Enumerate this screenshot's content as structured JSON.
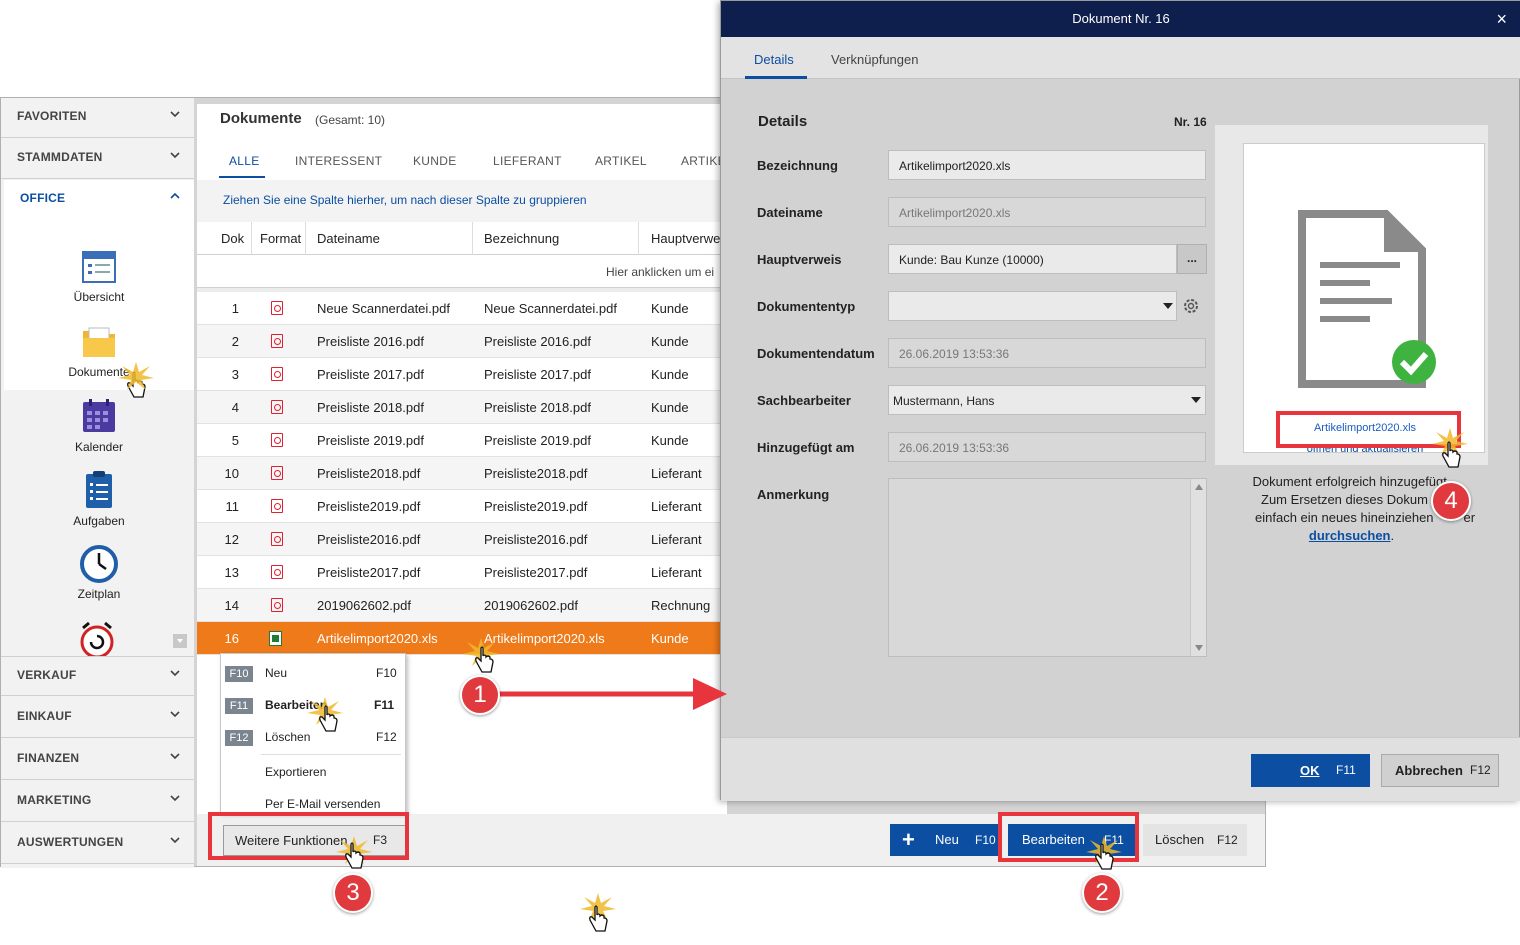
{
  "sidebar": {
    "sections": [
      "FAVORITEN",
      "STAMMDATEN",
      "OFFICE",
      "VERKAUF",
      "EINKAUF",
      "FINANZEN",
      "MARKETING",
      "AUSWERTUNGEN"
    ],
    "office_items": [
      "Übersicht",
      "Dokumente",
      "Kalender",
      "Aufgaben",
      "Zeitplan"
    ]
  },
  "documents": {
    "title": "Dokumente",
    "total": "(Gesamt: 10)",
    "tabs": [
      "ALLE",
      "INTERESSENT",
      "KUNDE",
      "LIEFERANT",
      "ARTIKEL",
      "ARTIKE"
    ],
    "group_hint": "Ziehen Sie eine Spalte hierher, um nach dieser Spalte zu gruppieren",
    "columns": [
      "Dok",
      "Format",
      "Dateiname",
      "Bezeichnung",
      "Hauptverwe"
    ],
    "filter_hint": "Hier anklicken um ei",
    "rows": [
      {
        "nr": "1",
        "file": "Neue Scannerdatei.pdf",
        "desc": "Neue Scannerdatei.pdf",
        "ref": "Kunde",
        "fmt": "pdf"
      },
      {
        "nr": "2",
        "file": "Preisliste 2016.pdf",
        "desc": "Preisliste 2016.pdf",
        "ref": "Kunde",
        "fmt": "pdf"
      },
      {
        "nr": "3",
        "file": "Preisliste 2017.pdf",
        "desc": "Preisliste 2017.pdf",
        "ref": "Kunde",
        "fmt": "pdf"
      },
      {
        "nr": "4",
        "file": "Preisliste 2018.pdf",
        "desc": "Preisliste 2018.pdf",
        "ref": "Kunde",
        "fmt": "pdf"
      },
      {
        "nr": "5",
        "file": "Preisliste 2019.pdf",
        "desc": "Preisliste 2019.pdf",
        "ref": "Kunde",
        "fmt": "pdf"
      },
      {
        "nr": "10",
        "file": "Preisliste2018.pdf",
        "desc": "Preisliste2018.pdf",
        "ref": "Lieferant",
        "fmt": "pdf"
      },
      {
        "nr": "11",
        "file": "Preisliste2019.pdf",
        "desc": "Preisliste2019.pdf",
        "ref": "Lieferant",
        "fmt": "pdf"
      },
      {
        "nr": "12",
        "file": "Preisliste2016.pdf",
        "desc": "Preisliste2016.pdf",
        "ref": "Lieferant",
        "fmt": "pdf"
      },
      {
        "nr": "13",
        "file": "Preisliste2017.pdf",
        "desc": "Preisliste2017.pdf",
        "ref": "Lieferant",
        "fmt": "pdf"
      },
      {
        "nr": "14",
        "file": "2019062602.pdf",
        "desc": "2019062602.pdf",
        "ref": "Rechnung",
        "fmt": "pdf"
      },
      {
        "nr": "16",
        "file": "Artikelimport2020.xls",
        "desc": "Artikelimport2020.xls",
        "ref": "Kunde",
        "fmt": "xls"
      }
    ]
  },
  "context_menu": [
    {
      "key": "F10",
      "label": "Neu",
      "shortcut": "F10"
    },
    {
      "key": "F11",
      "label": "Bearbeiten",
      "shortcut": "F11"
    },
    {
      "key": "F12",
      "label": "Löschen",
      "shortcut": "F12"
    },
    {
      "key": "",
      "label": "Exportieren",
      "shortcut": ""
    },
    {
      "key": "",
      "label": "Per E-Mail versenden",
      "shortcut": ""
    }
  ],
  "bottom_bar": {
    "more_label": "Weitere Funktionen",
    "more_key": "F3",
    "new_label": "Neu",
    "new_key": "F10",
    "edit_label": "Bearbeiten",
    "edit_key": "F11",
    "delete_label": "Löschen",
    "delete_key": "F12"
  },
  "dialog": {
    "title": "Dokument Nr. 16",
    "tabs": [
      "Details",
      "Verknüpfungen"
    ],
    "section": "Details",
    "nr": "Nr. 16",
    "labels": {
      "bezeichnung": "Bezeichnung",
      "dateiname": "Dateiname",
      "hauptverweis": "Hauptverweis",
      "dokumententyp": "Dokumententyp",
      "dokumentendatum": "Dokumentendatum",
      "sachbearbeiter": "Sachbearbeiter",
      "hinzugefuegt": "Hinzugefügt am",
      "anmerkung": "Anmerkung"
    },
    "values": {
      "bezeichnung": "Artikelimport2020.xls",
      "dateiname": "Artikelimport2020.xls",
      "hauptverweis": "Kunde: Bau Kunze (10000)",
      "dokumententyp": "",
      "dokumentendatum": "26.06.2019 13:53:36",
      "sachbearbeiter": "Mustermann, Hans",
      "hinzugefuegt": "26.06.2019 13:53:36"
    },
    "browse_label": "...",
    "preview_file": "Artikelimport2020.xls",
    "preview_link": "öffnen und aktualisieren",
    "msg_line1": "Dokument erfolgreich hinzugefügt.",
    "msg_line2": "Zum Ersetzen dieses Dokum",
    "msg_line3": "einfach ein neues hineinziehen",
    "msg_line3b": "er",
    "msg_link": "durchsuchen",
    "msg_end": ".",
    "ok_label": "OK",
    "ok_key": "F11",
    "cancel_label": "Abbrechen",
    "cancel_key": "F12",
    "close": "×"
  },
  "steps": [
    "1",
    "2",
    "3",
    "4"
  ],
  "colors": {
    "accent": "#0b4ea2",
    "selected_row": "#ef7a1a",
    "title_bar": "#0f1f4d",
    "highlight": "#e8343c",
    "badge": "#e0393e"
  }
}
